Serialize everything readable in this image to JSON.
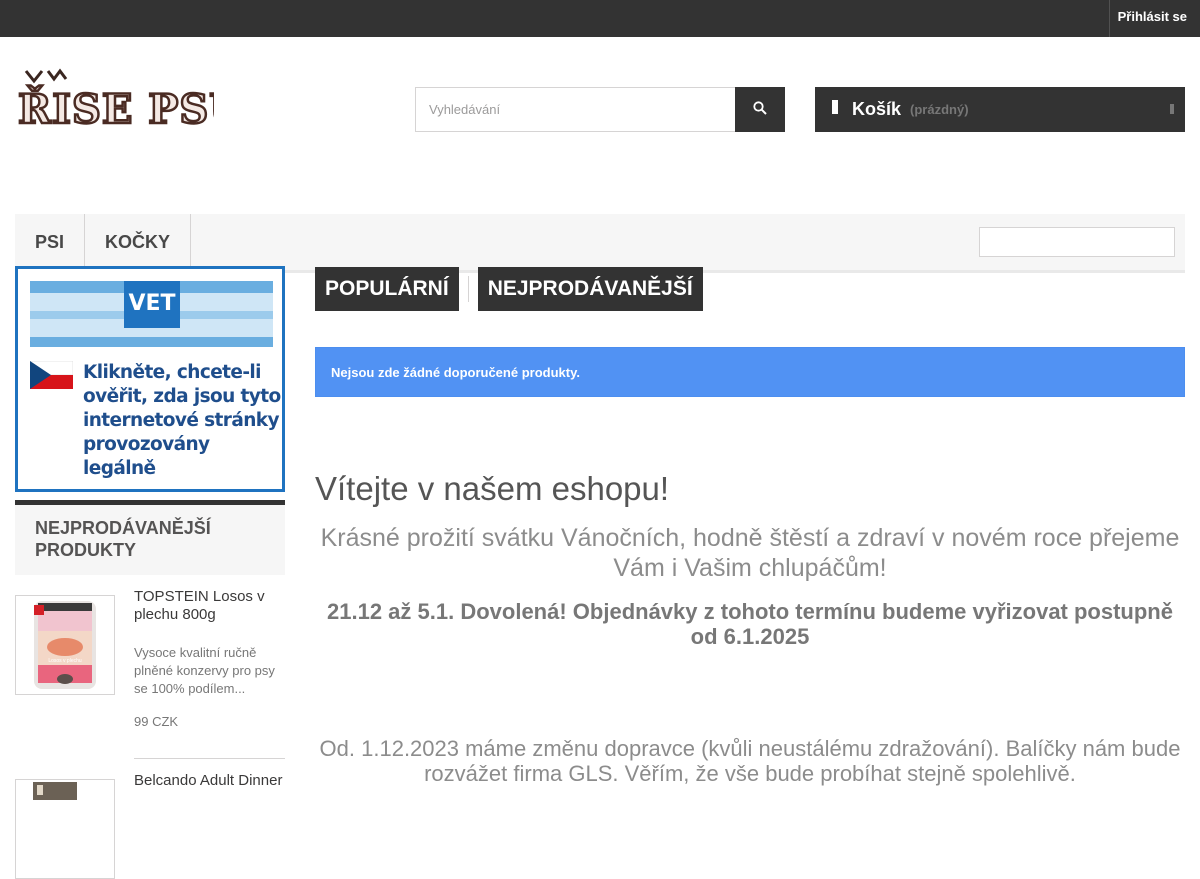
{
  "topbar": {
    "login": "Přihlásit se"
  },
  "header": {
    "logo": {
      "text_top": "VAV",
      "text_main": "ŘÍSE PSŮ"
    },
    "search": {
      "placeholder": "Vyhledávání",
      "icon": "search-icon"
    },
    "cart": {
      "label": "Košík",
      "status": "(prázdný)",
      "icon": "cart-icon"
    }
  },
  "menu": {
    "items": [
      "PSI",
      "KOČKY"
    ]
  },
  "left": {
    "vet_banner": {
      "badge": "VET",
      "text": "Klikněte, chcete-li ověřit, zda jsou tyto internetové stránky provozovány legálně"
    },
    "bestsellers": {
      "title": "NEJPRODÁVANĚJŠÍ PRODUKTY",
      "products": [
        {
          "name": "TOPSTEIN Losos v plechu 800g",
          "desc": "Vysoce kvalitní ručně plněné konzervy pro psy se 100% podílem...",
          "price": "99 CZK",
          "img_text": "Losos v plechu"
        },
        {
          "name": "Belcando Adult Dinner",
          "desc": "",
          "price": ""
        }
      ]
    }
  },
  "main": {
    "tabs": [
      "POPULÁRNÍ",
      "NEJPRODÁVANĚJŠÍ"
    ],
    "alert": "Nejsou zde žádné doporučené produkty.",
    "welcome": "Vítejte v našem eshopu!",
    "msg1": "Krásné prožití svátku Vánočních, hodně štěstí a zdraví v novém  roce přejeme Vám i Vašim chlupáčům!",
    "msg2": "21.12 až 5.1. Dovolená! Objednávky z tohoto termínu budeme vyřizovat postupně od 6.1.2025",
    "msg3": "Od. 1.12.2023 máme změnu dopravce (kvůli neustálému zdražování). Balíčky nám bude rozvážet firma GLS. Věřím, že vše bude probíhat stejně spolehlivě."
  },
  "colors": {
    "dark": "#333333",
    "alert_blue": "#5192f3",
    "vet_blue": "#1f73c0"
  }
}
